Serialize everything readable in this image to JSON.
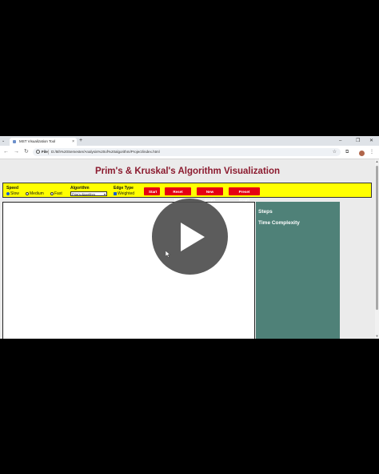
{
  "browser": {
    "tab_title": "MST Visualization Tool",
    "tab_close": "×",
    "new_tab": "+",
    "tab_list": "⌄",
    "win_min": "–",
    "win_max": "❐",
    "win_close": "✕",
    "nav_back": "←",
    "nav_forward": "→",
    "nav_reload": "↻",
    "file_chip": "File",
    "url": "D:/5th%20Semester/Analysis%20of%20algorithm/Project/index.html",
    "star": "☆",
    "extensions": "⧉",
    "kebab": "⋮"
  },
  "page": {
    "title": "Prim's & Kruskal's Algorithm Visualization",
    "title_color": "#8b1a2e"
  },
  "controls": {
    "background": "#ffff00",
    "speed": {
      "label": "Speed",
      "options": [
        "Slow",
        "Medium",
        "Fast"
      ],
      "selected": "Slow"
    },
    "algorithm": {
      "label": "Algorithm",
      "selected": "Prim's Algorithm"
    },
    "edge_type": {
      "label": "Edge Type",
      "option": "Weighted",
      "checked": true
    },
    "buttons": {
      "start": "Start",
      "reset_mst": "Reset MST",
      "new_graph": "New Graph",
      "preset_graph": "Preset Graph"
    },
    "button_color": "#e60012"
  },
  "sidebar": {
    "background": "#4f8178",
    "steps_heading": "Steps",
    "time_heading": "Time Complexity"
  },
  "overlay": {
    "icon": "play-icon"
  }
}
